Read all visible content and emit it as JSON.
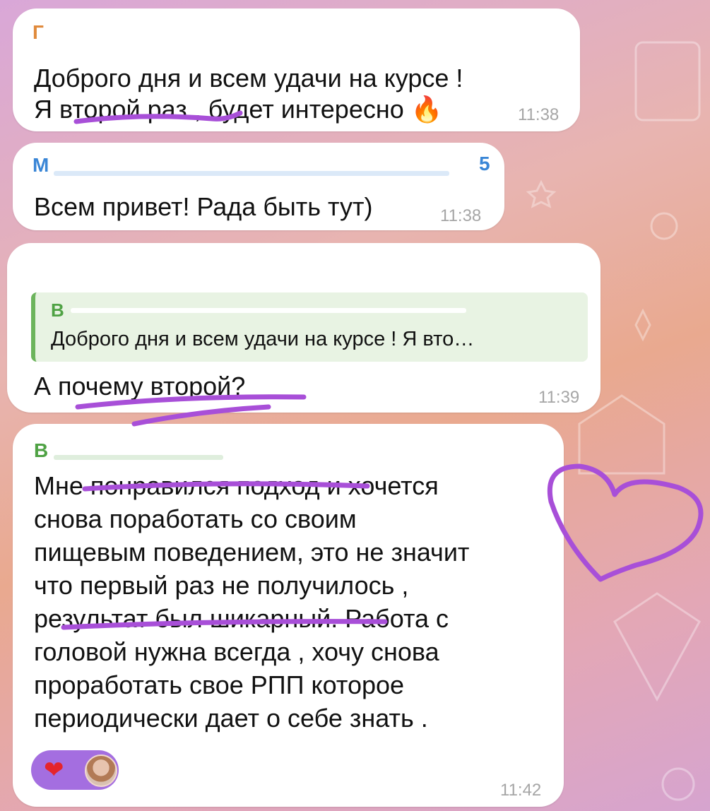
{
  "colors": {
    "bubble": "#ffffff",
    "sender_1": "#e08a3c",
    "sender_2": "#3a86d6",
    "sender_4": "#4fa244",
    "quote_bar": "#6cb45c",
    "reaction": "#a46ee0",
    "annotation": "#a84fd8"
  },
  "messages": [
    {
      "sender": "Г",
      "lines": [
        "Доброго дня и всем удачи на курсе !",
        "Я второй раз , будет интересно 🔥"
      ],
      "time": "11:38"
    },
    {
      "sender": "М",
      "sender_tail": "5",
      "lines": [
        "Всем привет! Рада быть тут)"
      ],
      "time": "11:38"
    },
    {
      "reply": {
        "author": "В",
        "text": "Доброго дня и всем удачи на курсе ! Я вто…"
      },
      "lines": [
        "А почему второй?"
      ],
      "time": "11:39"
    },
    {
      "sender": "В",
      "lines": [
        "Мне понравился подход и хочется",
        "снова поработать со своим",
        "пищевым поведением, это не значит",
        "что первый раз не получилось ,",
        "результат был шикарный. Работа с",
        "головой нужна всегда , хочу снова",
        "проработать свое РПП которое",
        "периодически дает о себе знать ."
      ],
      "reactions": [
        {
          "emoji": "heart-icon"
        },
        {
          "emoji": "avatar"
        }
      ],
      "time": "11:42"
    }
  ]
}
